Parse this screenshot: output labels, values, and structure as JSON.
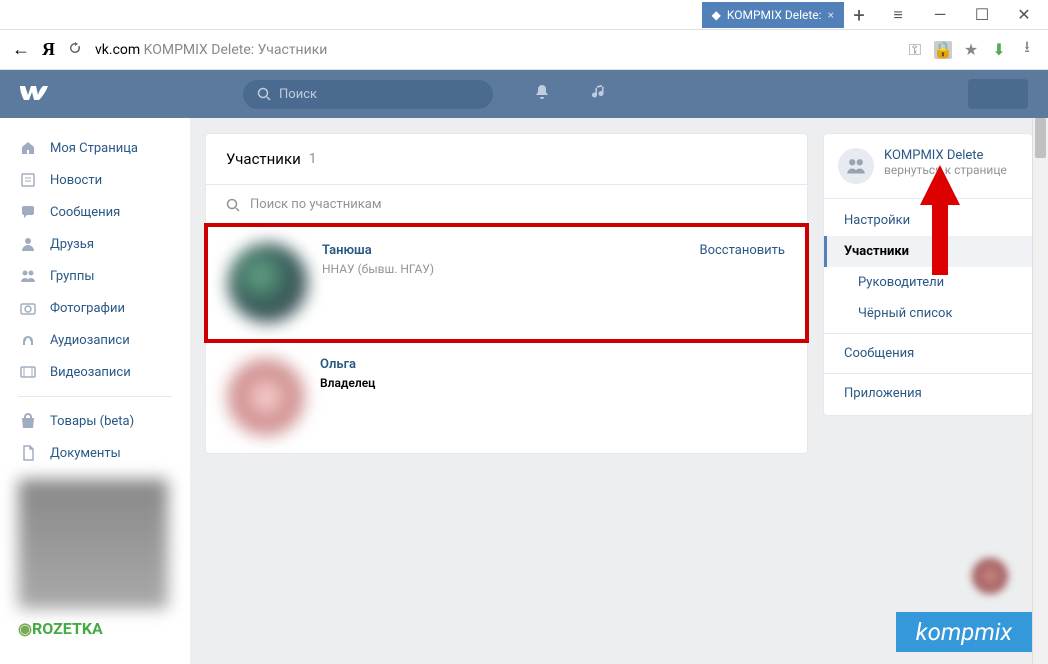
{
  "window": {
    "tab_title": "KOMPMIX Delete:"
  },
  "addr": {
    "domain": "vk.com",
    "path": " KOMPMIX Delete: Участники"
  },
  "vk_header": {
    "search_placeholder": "Поиск"
  },
  "nav": {
    "items": [
      {
        "label": "Моя Страница"
      },
      {
        "label": "Новости"
      },
      {
        "label": "Сообщения"
      },
      {
        "label": "Друзья"
      },
      {
        "label": "Группы"
      },
      {
        "label": "Фотографии"
      },
      {
        "label": "Аудиозаписи"
      },
      {
        "label": "Видеозаписи"
      }
    ],
    "items2": [
      {
        "label": "Товары (beta)"
      },
      {
        "label": "Документы"
      }
    ],
    "ad_brand": "ROZETKA"
  },
  "main": {
    "title": "Участники",
    "count": "1",
    "search_placeholder": "Поиск по участникам",
    "members": [
      {
        "name": "Танюша",
        "sub": "ННАУ (бывш. НГАУ)",
        "action": "Восстановить"
      },
      {
        "name": "Ольга",
        "role": "Владелец"
      }
    ]
  },
  "side": {
    "group_name": "KOMPMIX Delete",
    "group_back": "вернуться к странице",
    "menu": [
      {
        "label": "Настройки"
      },
      {
        "label": "Участники",
        "selected": true
      },
      {
        "label": "Руководители",
        "indent": true
      },
      {
        "label": "Чёрный список",
        "indent": true
      },
      {
        "label": "Сообщения"
      },
      {
        "label": "Приложения"
      }
    ]
  },
  "watermark": "kompmix"
}
